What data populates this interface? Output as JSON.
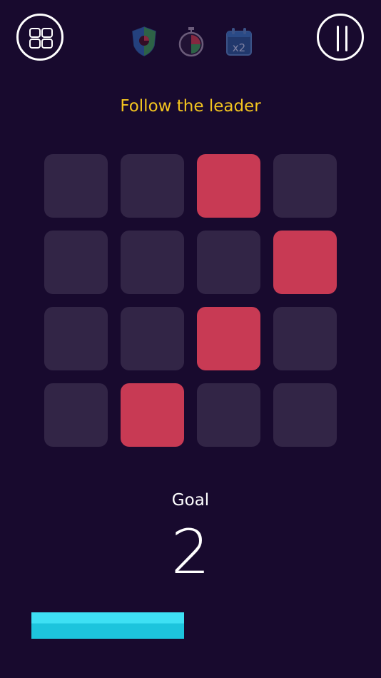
{
  "header": {
    "menu_icon": "grid-menu-icon",
    "pause_icon": "pause-icon",
    "powerups": [
      {
        "icon": "shield-powerup-icon"
      },
      {
        "icon": "stopwatch-powerup-icon"
      },
      {
        "icon": "double-calendar-powerup-icon",
        "label": "x2"
      }
    ]
  },
  "instruction": "Follow the leader",
  "board": {
    "rows": 4,
    "cols": 4,
    "lit_tiles": [
      [
        0,
        2
      ],
      [
        1,
        3
      ],
      [
        2,
        2
      ],
      [
        3,
        1
      ]
    ],
    "colors": {
      "tile": "#322546",
      "lit": "#c83a54"
    }
  },
  "goal": {
    "label": "Goal",
    "value": "2"
  },
  "progress": {
    "fraction": 0.48,
    "color": "#1dc4dd"
  },
  "colors": {
    "background": "#180a2e",
    "accent": "#f4c51f"
  }
}
